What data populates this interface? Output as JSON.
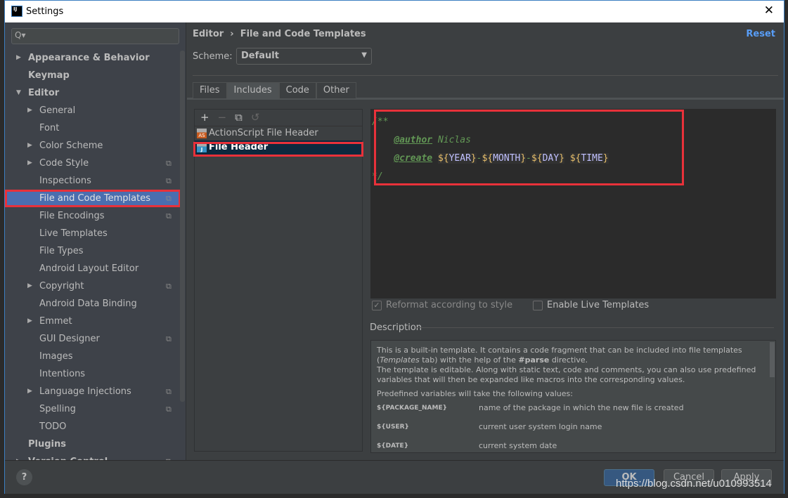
{
  "window": {
    "title": "Settings",
    "logo": "IJ"
  },
  "sidebar": {
    "search_placeholder": "Q▾",
    "items": [
      {
        "label": "Appearance & Behavior",
        "level": 0,
        "bold": true,
        "arrow": "right"
      },
      {
        "label": "Keymap",
        "level": 0,
        "bold": true
      },
      {
        "label": "Editor",
        "level": 0,
        "bold": true,
        "arrow": "down"
      },
      {
        "label": "General",
        "level": 1,
        "arrow": "right"
      },
      {
        "label": "Font",
        "level": 1
      },
      {
        "label": "Color Scheme",
        "level": 1,
        "arrow": "right"
      },
      {
        "label": "Code Style",
        "level": 1,
        "arrow": "right",
        "copy": true
      },
      {
        "label": "Inspections",
        "level": 1,
        "copy": true
      },
      {
        "label": "File and Code Templates",
        "level": 1,
        "copy": true,
        "selected": true
      },
      {
        "label": "File Encodings",
        "level": 1,
        "copy": true
      },
      {
        "label": "Live Templates",
        "level": 1
      },
      {
        "label": "File Types",
        "level": 1
      },
      {
        "label": "Android Layout Editor",
        "level": 1
      },
      {
        "label": "Copyright",
        "level": 1,
        "arrow": "right",
        "copy": true
      },
      {
        "label": "Android Data Binding",
        "level": 1
      },
      {
        "label": "Emmet",
        "level": 1,
        "arrow": "right"
      },
      {
        "label": "GUI Designer",
        "level": 1,
        "copy": true
      },
      {
        "label": "Images",
        "level": 1
      },
      {
        "label": "Intentions",
        "level": 1
      },
      {
        "label": "Language Injections",
        "level": 1,
        "arrow": "right",
        "copy": true
      },
      {
        "label": "Spelling",
        "level": 1,
        "copy": true
      },
      {
        "label": "TODO",
        "level": 1
      },
      {
        "label": "Plugins",
        "level": 0,
        "bold": true
      },
      {
        "label": "Version Control",
        "level": 0,
        "bold": true,
        "arrow": "right",
        "copy": true
      }
    ]
  },
  "breadcrumb": {
    "parent": "Editor",
    "sep": "›",
    "current": "File and Code Templates"
  },
  "reset": "Reset",
  "scheme": {
    "label": "Scheme:",
    "value": "Default"
  },
  "tabs": [
    {
      "label": "Files"
    },
    {
      "label": "Includes",
      "active": true
    },
    {
      "label": "Code"
    },
    {
      "label": "Other"
    }
  ],
  "toolbar": {
    "add": "+",
    "remove": "−",
    "copy": "⧉",
    "reset": "↺"
  },
  "templates": [
    {
      "label": "ActionScript File Header",
      "icon": "AS",
      "color": "#c75a1e"
    },
    {
      "label": "File Header",
      "icon": "J",
      "color": "#3592c4",
      "selected": true
    }
  ],
  "editor": {
    "open": "/**",
    "author_tag": "@author",
    "author": "Niclas",
    "create_tag": "@create",
    "vars": [
      "YEAR",
      "MONTH",
      "DAY",
      "TIME"
    ],
    "close": "*/"
  },
  "options": {
    "reformat": "Reformat according to style",
    "reformat_checked": true,
    "live": "Enable Live Templates",
    "live_checked": false
  },
  "description": {
    "label": "Description",
    "p1a": "This is a built-in template. It contains a code fragment that can be included into file templates (",
    "p1i": "Templates",
    "p1b": " tab) with the help of the ",
    "p1c": "#parse",
    "p1d": " directive.",
    "p2": "The template is editable. Along with static text, code and comments, you can also use predefined variables that will then be expanded like macros into the corresponding values.",
    "p3": "Predefined variables will take the following values:",
    "vars": [
      {
        "name": "${PACKAGE_NAME}",
        "desc": "name of the package in which the new file is created"
      },
      {
        "name": "${USER}",
        "desc": "current user system login name"
      },
      {
        "name": "${DATE}",
        "desc": "current system date"
      }
    ]
  },
  "buttons": {
    "help": "?",
    "ok": "OK",
    "cancel": "Cancel",
    "apply": "Apply"
  },
  "watermark": "https://blog.csdn.net/u010993514"
}
